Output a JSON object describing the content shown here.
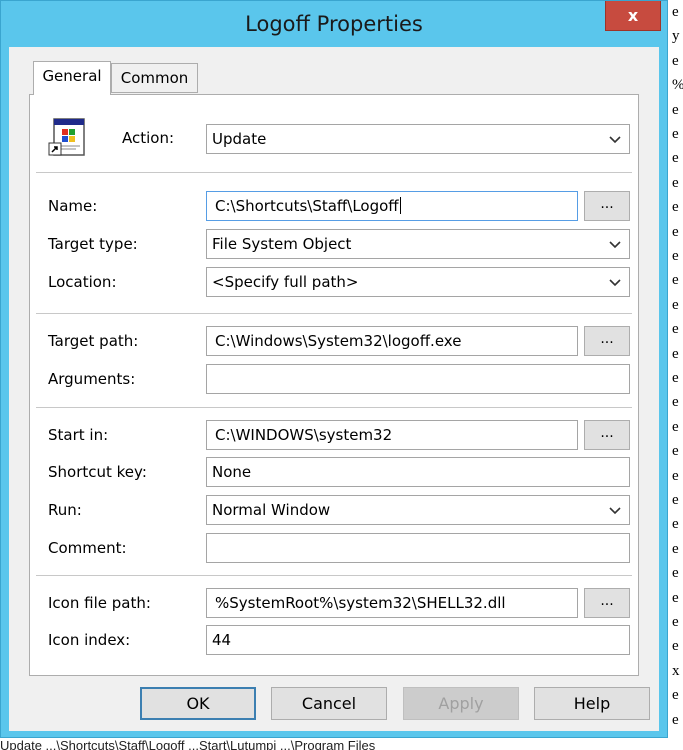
{
  "window": {
    "title": "Logoff Properties",
    "close_label": "x"
  },
  "tabs": [
    {
      "label": "General"
    },
    {
      "label": "Common"
    }
  ],
  "form": {
    "action": {
      "label": "Action:",
      "value": "Update"
    },
    "name": {
      "label": "Name:",
      "value": "C:\\Shortcuts\\Staff\\Logoff"
    },
    "target_type": {
      "label": "Target type:",
      "value": "File System Object"
    },
    "location": {
      "label": "Location:",
      "value": "<Specify full path>"
    },
    "target_path": {
      "label": "Target path:",
      "value": "C:\\Windows\\System32\\logoff.exe"
    },
    "arguments": {
      "label": "Arguments:",
      "value": ""
    },
    "start_in": {
      "label": "Start in:",
      "value": "C:\\WINDOWS\\system32"
    },
    "shortcut_key": {
      "label": "Shortcut key:",
      "value": "None"
    },
    "run": {
      "label": "Run:",
      "value": "Normal Window"
    },
    "comment": {
      "label": "Comment:",
      "value": ""
    },
    "icon_file_path": {
      "label": "Icon file path:",
      "value": "%SystemRoot%\\system32\\SHELL32.dll"
    },
    "icon_index": {
      "label": "Icon index:",
      "value": "44"
    },
    "browse_label": "..."
  },
  "buttons": {
    "ok": "OK",
    "cancel": "Cancel",
    "apply": "Apply",
    "help": "Help"
  },
  "background_doc": {
    "right_edge_chars": [
      "e",
      "y",
      "e",
      "%",
      "e",
      "e",
      "e",
      "e",
      "e",
      "e",
      "e",
      "e",
      "e",
      "e",
      "e",
      "e",
      "e",
      "e",
      "e",
      "e",
      "e",
      "e",
      "e",
      "e",
      "e",
      "e",
      "e",
      "x",
      "e",
      "e"
    ],
    "bottom_fragment": "Update           ...\\Shortcuts\\Staff\\Logoff     ...Start\\Lutumpi ...\\Program Files"
  },
  "colors": {
    "title_bar": "#5ac6ec",
    "close_button": "#c74b3f",
    "focus_border": "#569de5"
  }
}
